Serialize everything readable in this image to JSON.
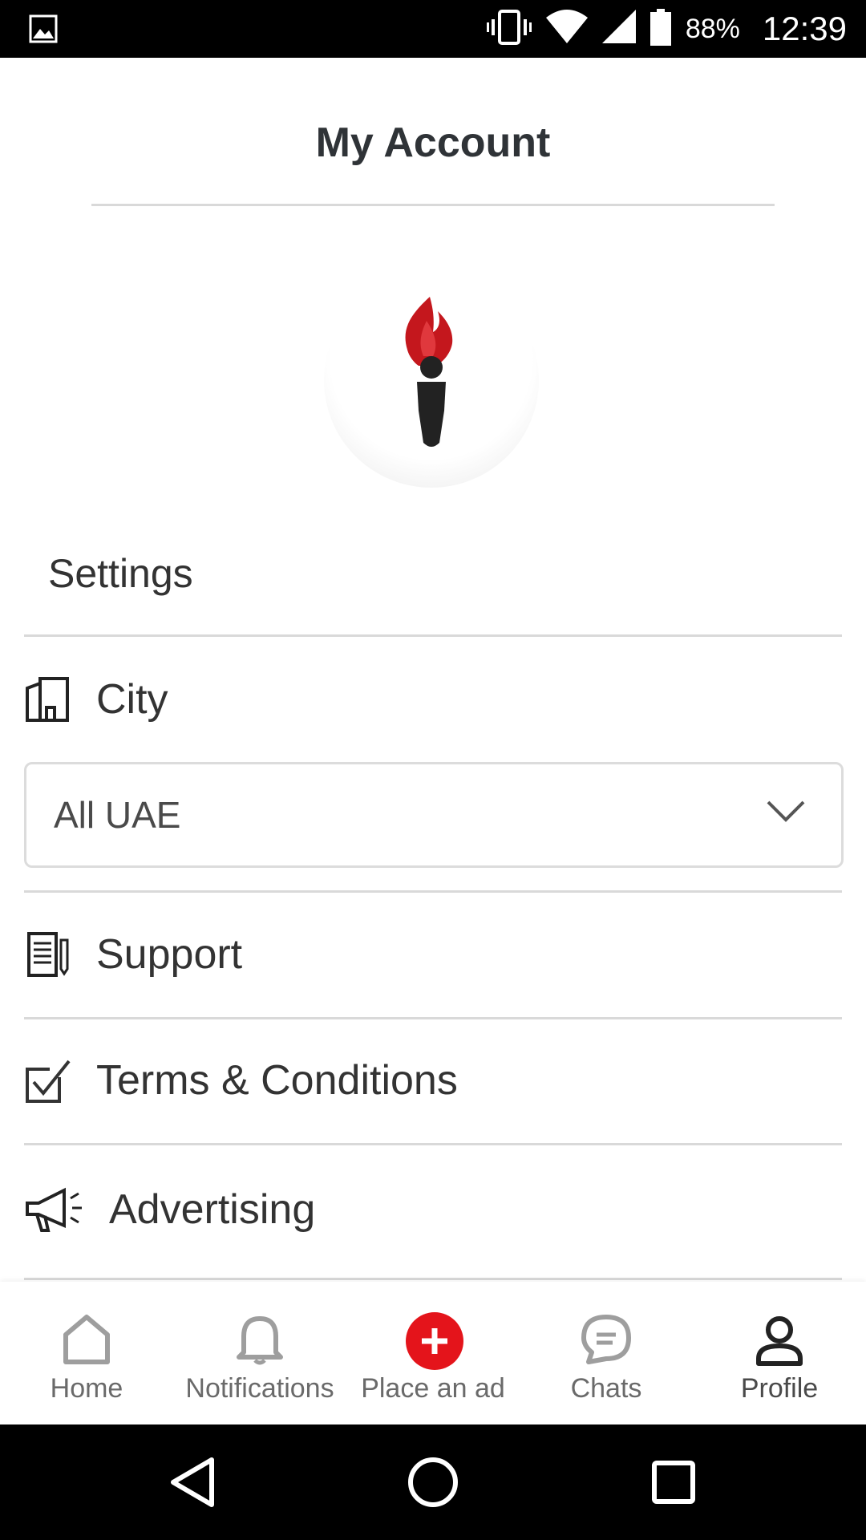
{
  "status_bar": {
    "battery": "88%",
    "time": "12:39",
    "icons": [
      "gallery-icon",
      "vibrate-icon",
      "wifi-icon",
      "signal-icon",
      "battery-icon"
    ]
  },
  "header": {
    "title": "My Account"
  },
  "settings": {
    "title": "Settings",
    "city": {
      "label": "City",
      "icon": "city-icon"
    },
    "city_select": {
      "value": "All UAE"
    },
    "items": [
      {
        "label": "Support",
        "icon": "support-icon"
      },
      {
        "label": "Terms & Conditions",
        "icon": "checkbox-icon"
      },
      {
        "label": "Advertising",
        "icon": "megaphone-icon"
      }
    ]
  },
  "bottom_nav": {
    "items": [
      {
        "label": "Home",
        "icon": "home-icon"
      },
      {
        "label": "Notifications",
        "icon": "bell-icon"
      },
      {
        "label": "Place an ad",
        "icon": "plus-icon"
      },
      {
        "label": "Chats",
        "icon": "chat-icon"
      },
      {
        "label": "Profile",
        "icon": "profile-icon"
      }
    ],
    "active": "Profile"
  },
  "colors": {
    "accent": "#e4141b",
    "text": "#333333",
    "divider": "#d9d9d9",
    "nav_inactive": "#9e9e9e"
  }
}
